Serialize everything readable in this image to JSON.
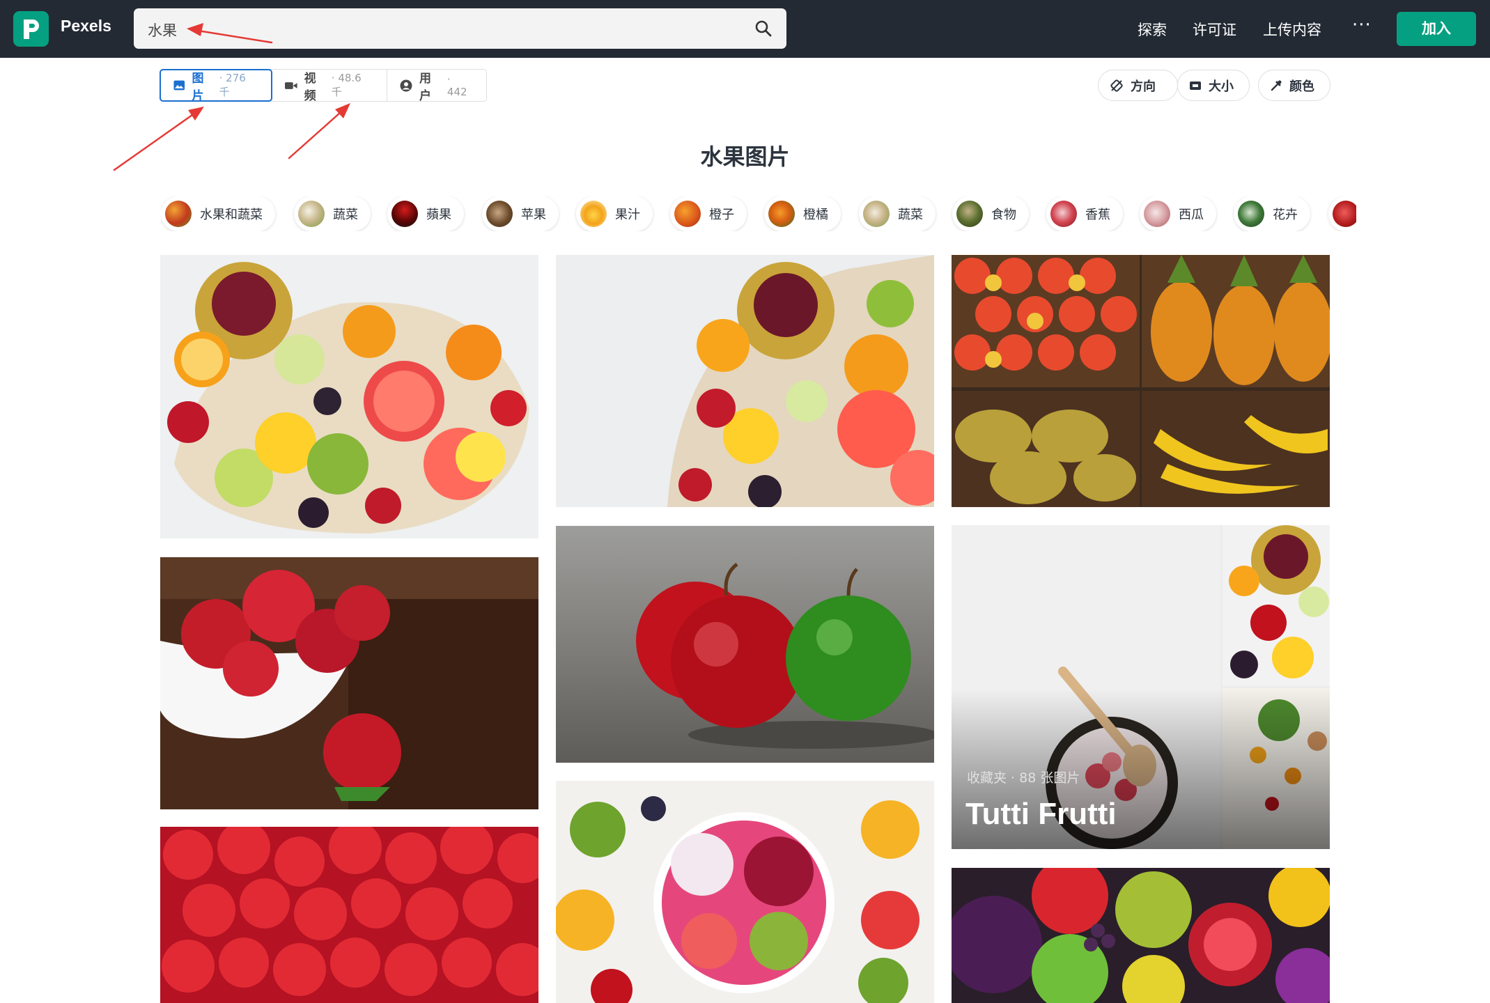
{
  "header": {
    "brand": "Pexels",
    "search_value": "水果",
    "nav": [
      "探索",
      "许可证",
      "上传内容"
    ],
    "more_label": "···",
    "join_label": "加入"
  },
  "tabs": [
    {
      "label": "图片",
      "count": "· 276 千",
      "icon": "image-icon",
      "active": true
    },
    {
      "label": "视频",
      "count": "· 48.6 千",
      "icon": "video-icon",
      "active": false
    },
    {
      "label": "用户",
      "count": "· 442",
      "icon": "user-icon",
      "active": false
    }
  ],
  "filters": [
    {
      "label": "方向",
      "icon": "orientation-icon"
    },
    {
      "label": "大小",
      "icon": "size-icon"
    },
    {
      "label": "颜色",
      "icon": "color-picker-icon"
    }
  ],
  "page_title": "水果图片",
  "chips": [
    "水果和蔬菜",
    "蔬菜",
    "蘋果",
    "苹果",
    "果汁",
    "橙子",
    "橙橘",
    "蔬菜",
    "食物",
    "香蕉",
    "西瓜",
    "花卉"
  ],
  "collection": {
    "meta": "收藏夹 · 88 张图片",
    "title": "Tutti Frutti"
  },
  "colors": {
    "topbar": "#232a34",
    "brand_green": "#05a081",
    "active_tab": "#1a6fd0",
    "annotation_arrow": "#e53935"
  }
}
